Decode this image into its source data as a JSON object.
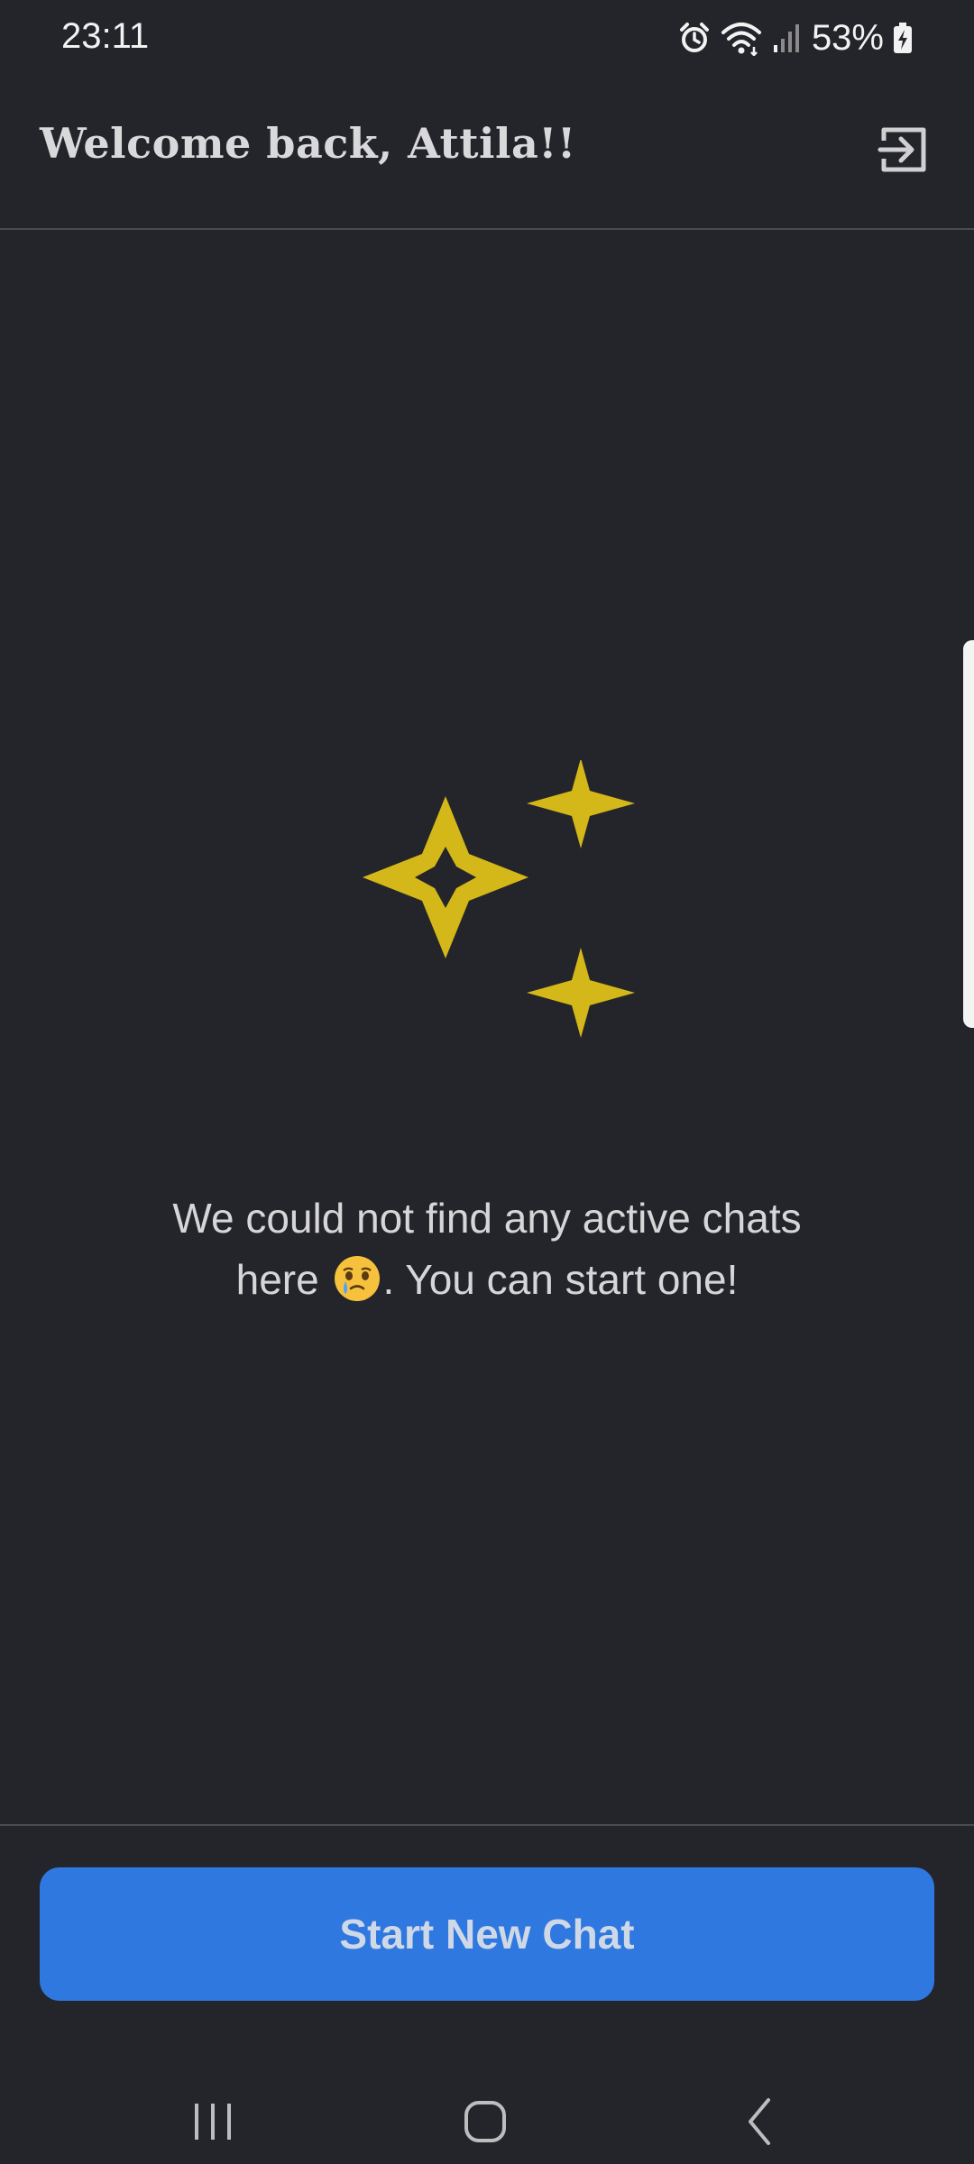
{
  "status_bar": {
    "time": "23:11",
    "battery": "53%",
    "icons": [
      "alarm-icon",
      "wifi-icon",
      "signal-icon",
      "battery-charging-icon"
    ]
  },
  "header": {
    "title": "Welcome back, Attila!!",
    "logout_icon": "logout-icon"
  },
  "empty_state": {
    "icon": "sparkles-icon",
    "message_line1": "We could not find any active chats",
    "message_line2_before": "here",
    "message_emoji": "face-holding-back-tears-emoji",
    "message_line2_after": ". You can start one!"
  },
  "footer": {
    "start_button_label": "Start New Chat"
  },
  "nav_bar": {
    "items": [
      "recent-apps-icon",
      "home-icon",
      "back-icon"
    ]
  },
  "colors": {
    "background": "#24252a",
    "accent": "#2f78e0",
    "sparkle": "#d4b719",
    "text": "#d6d6d8"
  }
}
